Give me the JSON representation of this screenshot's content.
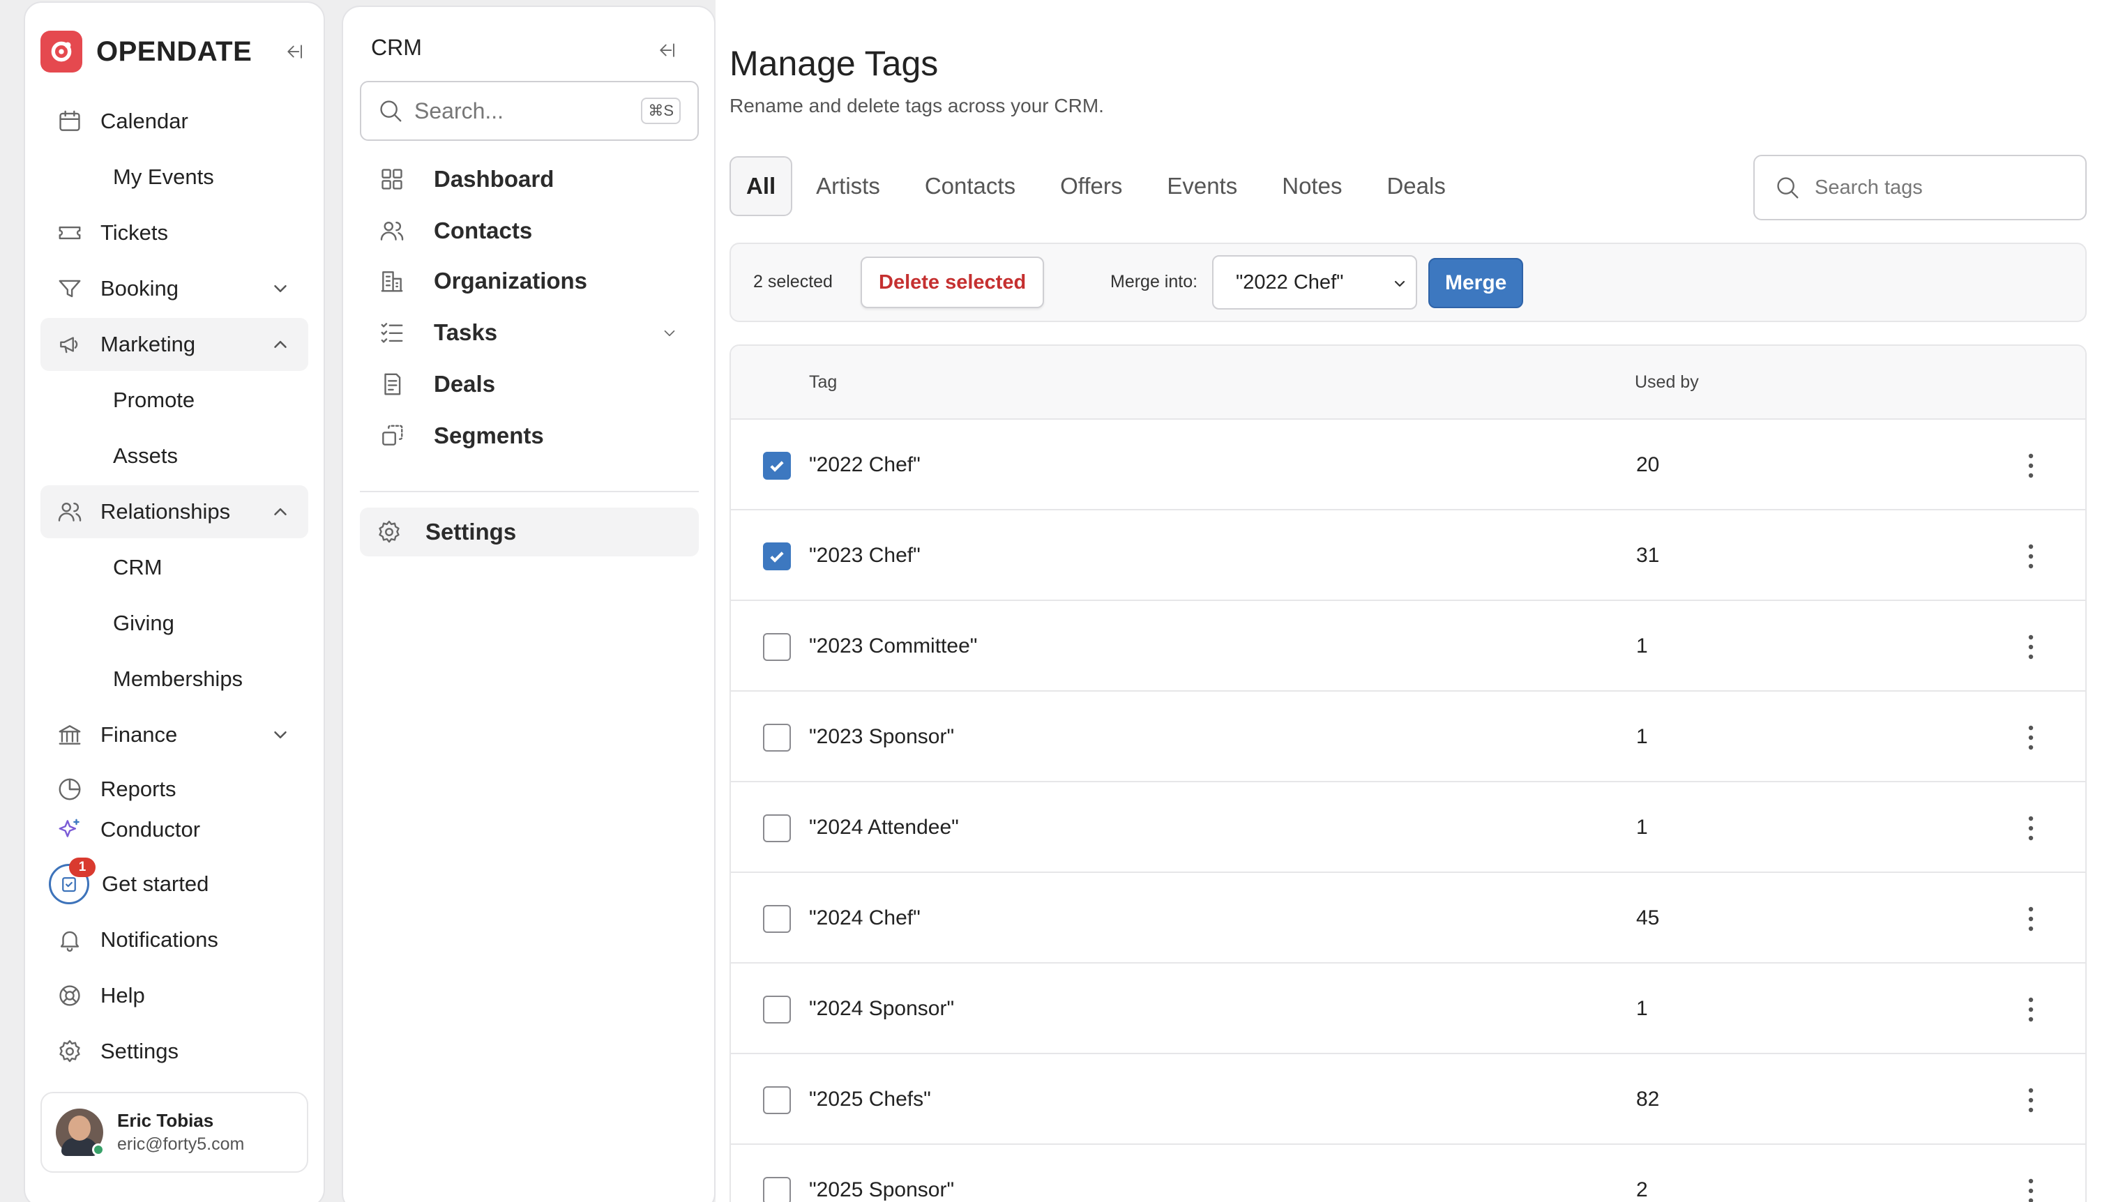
{
  "nav": {
    "logo_text": "OPENDATE",
    "items": [
      {
        "label": "Calendar",
        "icon": "calendar-icon"
      },
      {
        "label": "My Events"
      },
      {
        "label": "Tickets",
        "icon": "ticket-icon"
      },
      {
        "label": "Booking",
        "icon": "filter-icon"
      },
      {
        "label": "Marketing",
        "icon": "megaphone-icon"
      },
      {
        "label": "Promote"
      },
      {
        "label": "Assets"
      },
      {
        "label": "Relationships",
        "icon": "users-icon"
      },
      {
        "label": "CRM"
      },
      {
        "label": "Giving"
      },
      {
        "label": "Memberships"
      },
      {
        "label": "Finance",
        "icon": "bank-icon"
      },
      {
        "label": "Reports",
        "icon": "pie-chart-icon"
      },
      {
        "label": "Conductor",
        "icon": "sparkle-icon"
      },
      {
        "label": "Get started",
        "badge": "1"
      },
      {
        "label": "Notifications",
        "icon": "bell-icon"
      },
      {
        "label": "Help",
        "icon": "lifebuoy-icon"
      },
      {
        "label": "Settings",
        "icon": "gear-icon"
      }
    ],
    "user": {
      "name": "Eric Tobias",
      "email": "eric@forty5.com"
    }
  },
  "crm": {
    "title": "CRM",
    "search_placeholder": "Search...",
    "search_shortcut": "⌘S",
    "items": [
      {
        "label": "Dashboard",
        "icon": "grid-icon"
      },
      {
        "label": "Contacts",
        "icon": "users-icon"
      },
      {
        "label": "Organizations",
        "icon": "building-icon"
      },
      {
        "label": "Tasks",
        "icon": "checklist-icon"
      },
      {
        "label": "Deals",
        "icon": "receipt-icon"
      },
      {
        "label": "Segments",
        "icon": "segments-icon"
      },
      {
        "label": "Settings",
        "icon": "gear-icon"
      }
    ]
  },
  "main": {
    "title": "Manage Tags",
    "subtitle": "Rename and delete tags across your CRM.",
    "tabs": [
      "All",
      "Artists",
      "Contacts",
      "Offers",
      "Events",
      "Notes",
      "Deals"
    ],
    "active_tab": "All",
    "search_placeholder": "Search tags",
    "bulk": {
      "selected_text": "2 selected",
      "delete_label": "Delete selected",
      "merge_label": "Merge into:",
      "merge_value": "\"2022 Chef\"",
      "merge_button": "Merge"
    },
    "table": {
      "headers": {
        "tag": "Tag",
        "used_by": "Used by"
      },
      "rows": [
        {
          "tag": "\"2022 Chef\"",
          "used_by": "20",
          "checked": true
        },
        {
          "tag": "\"2023 Chef\"",
          "used_by": "31",
          "checked": true
        },
        {
          "tag": "\"2023 Committee\"",
          "used_by": "1",
          "checked": false
        },
        {
          "tag": "\"2023 Sponsor\"",
          "used_by": "1",
          "checked": false
        },
        {
          "tag": "\"2024 Attendee\"",
          "used_by": "1",
          "checked": false
        },
        {
          "tag": "\"2024 Chef\"",
          "used_by": "45",
          "checked": false
        },
        {
          "tag": "\"2024 Sponsor\"",
          "used_by": "1",
          "checked": false
        },
        {
          "tag": "\"2025 Chefs\"",
          "used_by": "82",
          "checked": false
        },
        {
          "tag": "\"2025 Sponsor\"",
          "used_by": "2",
          "checked": false
        }
      ]
    }
  },
  "colors": {
    "accent": "#3d78c0",
    "danger": "#c53030",
    "brand": "#e5494f",
    "badge": "#d93a2f"
  }
}
